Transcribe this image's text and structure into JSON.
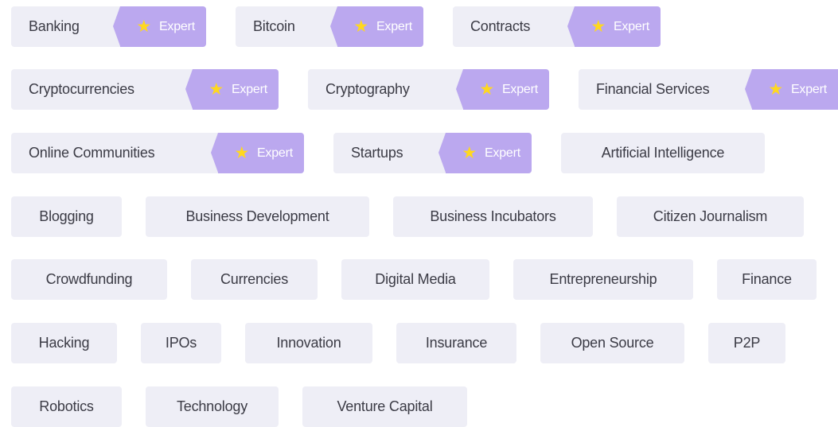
{
  "tags": [
    {
      "label": "Banking",
      "badge": "Expert",
      "star_icon": "★"
    },
    {
      "label": "Bitcoin",
      "badge": "Expert",
      "star_icon": "★"
    },
    {
      "label": "Contracts",
      "badge": "Expert",
      "star_icon": "★"
    },
    {
      "label": "Cryptocurrencies",
      "badge": "Expert",
      "star_icon": "★"
    },
    {
      "label": "Cryptography",
      "badge": "Expert",
      "star_icon": "★"
    },
    {
      "label": "Financial Services",
      "badge": "Expert",
      "star_icon": "★"
    },
    {
      "label": "Online Communities",
      "badge": "Expert",
      "star_icon": "★"
    },
    {
      "label": "Startups",
      "badge": "Expert",
      "star_icon": "★"
    },
    {
      "label": "Artificial Intelligence"
    },
    {
      "label": "Blogging"
    },
    {
      "label": "Business Development"
    },
    {
      "label": "Business Incubators"
    },
    {
      "label": "Citizen Journalism"
    },
    {
      "label": "Crowdfunding"
    },
    {
      "label": "Currencies"
    },
    {
      "label": "Digital Media"
    },
    {
      "label": "Entrepreneurship"
    },
    {
      "label": "Finance"
    },
    {
      "label": "Hacking"
    },
    {
      "label": "IPOs"
    },
    {
      "label": "Innovation"
    },
    {
      "label": "Insurance"
    },
    {
      "label": "Open Source"
    },
    {
      "label": "P2P"
    },
    {
      "label": "Robotics"
    },
    {
      "label": "Technology"
    },
    {
      "label": "Venture Capital"
    }
  ],
  "colors": {
    "tag_background": "#eeeef6",
    "tag_text": "#3b3b45",
    "badge_background": "#bba8ef",
    "badge_text": "#ffffff",
    "star": "#ffd81f"
  }
}
